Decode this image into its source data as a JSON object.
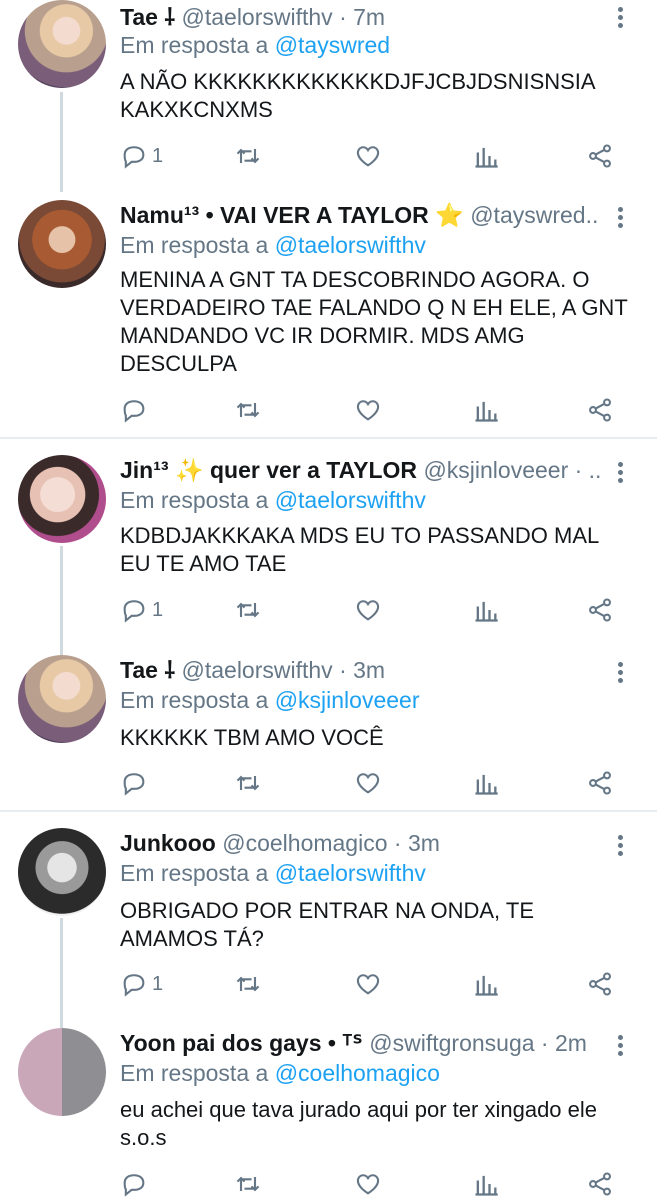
{
  "tweets": [
    {
      "name": "Tae ⸸",
      "handle": "@taelorswifthv",
      "time": "7m",
      "reply_label": "Em resposta a",
      "reply_to": "@tayswred",
      "text": "A NÃO KKKKKKKKKKKKKDJFJCBJDSNISNSIA KAKXKCNXMS",
      "reply_count": "1"
    },
    {
      "name": "Namu¹³ • VAI VER A TAYLOR ⭐",
      "handle": "@tayswred...",
      "time": "",
      "reply_label": "Em resposta a",
      "reply_to": "@taelorswifthv",
      "text": "MENINA A GNT TA DESCOBRINDO AGORA. O VERDADEIRO TAE FALANDO Q N EH ELE, A GNT MANDANDO VC IR DORMIR. MDS AMG DESCULPA",
      "reply_count": ""
    },
    {
      "name": "Jin¹³ ✨ quer ver a TAYLOR",
      "handle": "@ksjinloveeer · ...",
      "time": "",
      "reply_label": "Em resposta a",
      "reply_to": "@taelorswifthv",
      "text": "KDBDJAKKKAKA MDS EU TO PASSANDO MAL EU TE AMO TAE",
      "reply_count": "1"
    },
    {
      "name": "Tae ⸸",
      "handle": "@taelorswifthv",
      "time": "3m",
      "reply_label": "Em resposta a",
      "reply_to": "@ksjinloveeer",
      "text": "KKKKKK TBM AMO VOCÊ",
      "reply_count": ""
    },
    {
      "name": "Junkooo",
      "handle": "@coelhomagico",
      "time": "3m",
      "reply_label": "Em resposta a",
      "reply_to": "@taelorswifthv",
      "text": "OBRIGADO POR ENTRAR NA ONDA, TE AMAMOS TÁ?",
      "reply_count": "1"
    },
    {
      "name": "Yoon pai dos gays • ᵀᔆ",
      "handle": "@swiftgronsuga",
      "time": "2m",
      "reply_label": "Em resposta a",
      "reply_to": "@coelhomagico",
      "text": "eu achei que tava jurado aqui por ter xingado ele s.o.s",
      "reply_count": ""
    }
  ],
  "icons": {
    "reply": "reply-icon",
    "retweet": "retweet-icon",
    "like": "heart-icon",
    "stats": "analytics-icon",
    "share": "share-icon",
    "more": "more-vertical-icon"
  },
  "colors": {
    "link": "#1da1f2",
    "muted": "#657786",
    "text": "#14171a",
    "divider": "#e6ecf0",
    "thread": "#cfd9de"
  }
}
